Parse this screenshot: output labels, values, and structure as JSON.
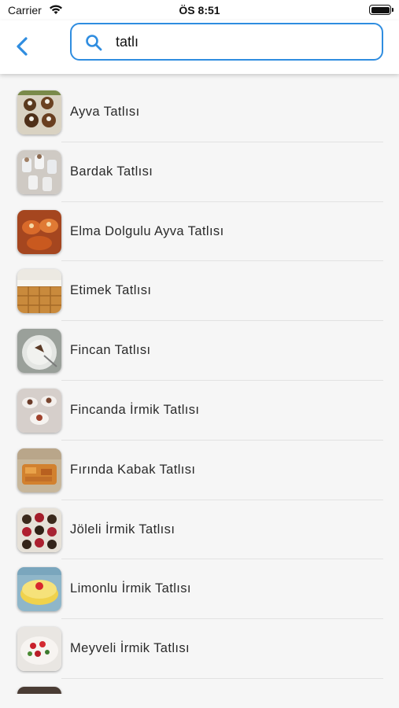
{
  "status_bar": {
    "carrier": "Carrier",
    "time": "ÖS 8:51"
  },
  "header": {
    "back_icon": "chevron-left-icon",
    "search_icon": "search-icon",
    "search_value": "tatlı",
    "accent_color": "#2f8de0"
  },
  "results": [
    {
      "label": "Ayva Tatlısı"
    },
    {
      "label": "Bardak Tatlısı"
    },
    {
      "label": "Elma Dolgulu Ayva Tatlısı"
    },
    {
      "label": "Etimek Tatlısı"
    },
    {
      "label": "Fincan Tatlısı"
    },
    {
      "label": "Fincanda İrmik Tatlısı"
    },
    {
      "label": "Fırında Kabak Tatlısı"
    },
    {
      "label": "Jöleli İrmik Tatlısı"
    },
    {
      "label": "Limonlu İrmik Tatlısı"
    },
    {
      "label": "Meyveli İrmik Tatlısı"
    }
  ]
}
